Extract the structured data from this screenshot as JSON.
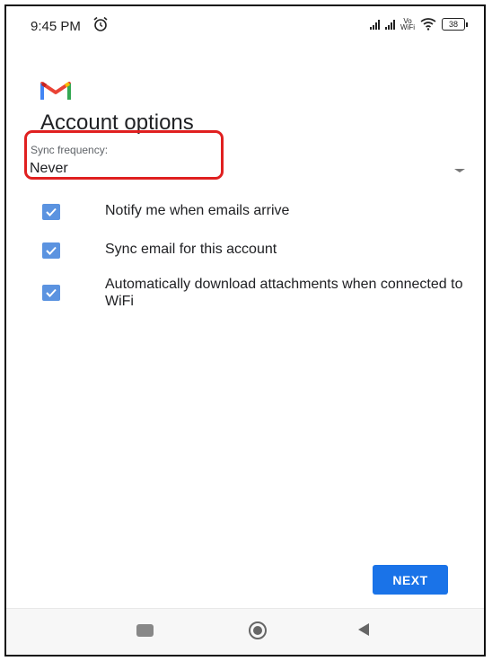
{
  "status_bar": {
    "time": "9:45 PM",
    "vowifi_top": "Vo",
    "vowifi_bottom": "WiFi",
    "battery": "38"
  },
  "page": {
    "title": "Account options",
    "sync_label": "Sync frequency:",
    "sync_value": "Never"
  },
  "options": [
    {
      "label": "Notify me when emails arrive",
      "checked": true
    },
    {
      "label": "Sync email for this account",
      "checked": true
    },
    {
      "label": "Automatically download attachments when connected to WiFi",
      "checked": true
    }
  ],
  "buttons": {
    "next": "NEXT"
  },
  "colors": {
    "accent": "#1a73e8",
    "checkbox": "#5b93e0",
    "highlight": "#e02020"
  },
  "icons": [
    "alarm-icon",
    "signal-icon",
    "vowifi-icon",
    "wifi-icon",
    "battery-icon",
    "gmail-logo-icon",
    "dropdown-arrow-icon",
    "checkbox-checked-icon",
    "nav-recents-icon",
    "nav-home-icon",
    "nav-back-icon"
  ]
}
